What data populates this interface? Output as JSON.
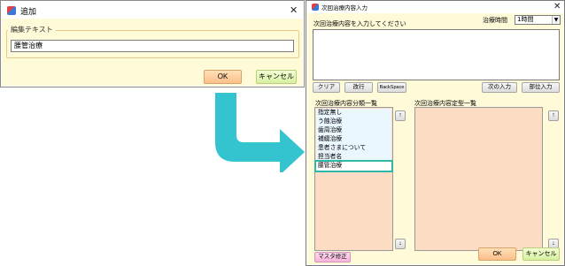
{
  "add_dialog": {
    "title": "追加",
    "close_glyph": "✕",
    "group_label": "編集テキスト",
    "text_value": "腰管治療",
    "ok_label": "OK",
    "cancel_label": "キャンセル"
  },
  "arrow": {
    "color": "#33c4cf"
  },
  "main_dialog": {
    "title": "次回治療内容入力",
    "close_glyph": "✕",
    "input_label": "次回治療内容を入力してください",
    "time_label": "治療時間",
    "time_value": "1時間",
    "text_area_value": "",
    "toolbar": {
      "clear": "クリア",
      "newline": "改行",
      "backspace": "BackSpace",
      "next_input": "次の入力",
      "part_input": "部位入力"
    },
    "category_label": "次回治療内容分類一覧",
    "categories": [
      "指定無し",
      "う蝕治療",
      "歯周治療",
      "補綴治療",
      "患者さまについて",
      "担当者名",
      "腰管治療"
    ],
    "selected_category_index": 6,
    "fixed_label": "次回治療内容定型一覧",
    "fixed_items": [],
    "up_glyph": "↑",
    "down_glyph": "↓",
    "master_label": "マスタ修正",
    "ok_label": "OK",
    "cancel_label": "キャンセル"
  },
  "colors": {
    "panel_bg": "#fffbd9",
    "list_bg": "#fcdcc2",
    "ok_button": "#fcc08a",
    "cancel_button": "#d6efa0",
    "selection_outline": "#2fb8a8"
  }
}
